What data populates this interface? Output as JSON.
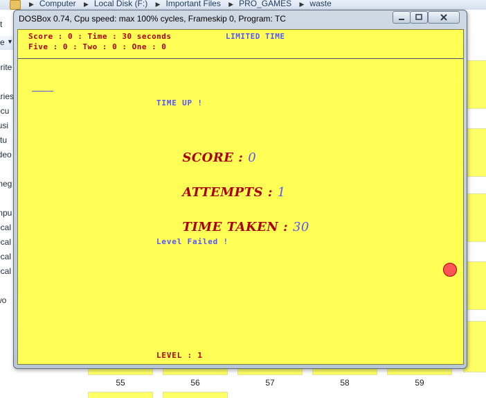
{
  "explorer": {
    "breadcrumbs": [
      "Computer",
      "Local Disk (F:)",
      "Important Files",
      "PRO_GAMES",
      "waste"
    ],
    "nav_partial_items": [
      "orite",
      "aries",
      "ocu",
      "lusi",
      "ctu",
      "ideo",
      "meg",
      "mpu",
      "ocal",
      "ocal",
      "ocal",
      "ocal",
      "wo"
    ],
    "nav_edge_labels": [
      "t",
      "e"
    ],
    "thumbnail_labels": [
      "55",
      "56",
      "57",
      "58",
      "59"
    ],
    "thumb_color": "#ffff66"
  },
  "dosbox": {
    "title": "DOSBox 0.74, Cpu speed: max 100% cycles, Frameskip  0, Program:     TC",
    "buttons": {
      "minimize": "minimize",
      "maximize": "maximize",
      "close": "close"
    },
    "screen_color": "#ffff55",
    "hud": {
      "line1": "Score : 0 : Time : 30 seconds",
      "line2": "Five : 0 : Two : 0 : One : 0",
      "mode": "LIMITED TIME"
    },
    "messages": {
      "time_up": "TIME UP !",
      "level_failed": "Level Failed !",
      "level": "LEVEL : 1"
    },
    "stats": {
      "score_label": "SCORE : ",
      "score_value": "0",
      "attempts_label": "ATTEMPTS : ",
      "attempts_value": "1",
      "time_label": "TIME TAKEN : ",
      "time_value": "30"
    },
    "colors": {
      "red_text": "#aa0000",
      "blue_text": "#5555ff",
      "ball": "#ff5555"
    }
  }
}
